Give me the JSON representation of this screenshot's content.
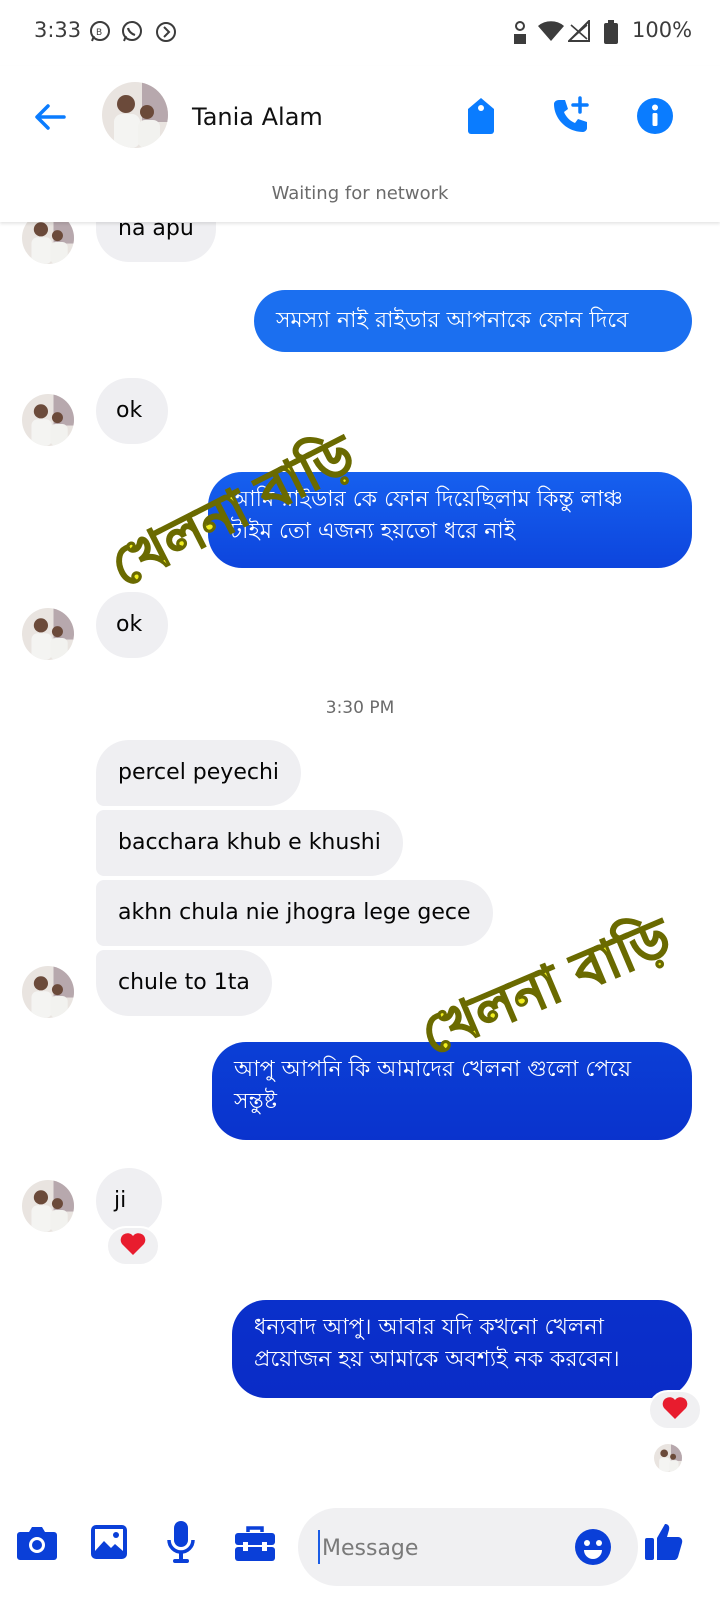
{
  "status_bar": {
    "time": "3:33",
    "battery": "100%",
    "icons": [
      "whatsapp-business-icon",
      "whatsapp-icon",
      "data-saver-icon",
      "location-icon",
      "wifi-icon",
      "signal-icon",
      "battery-icon"
    ]
  },
  "header": {
    "contact_name": "Tania Alam",
    "network_status": "Waiting for network",
    "icons": [
      "back-arrow-icon",
      "tag-icon",
      "add-call-icon",
      "info-icon"
    ]
  },
  "messages": [
    {
      "side": "in",
      "text": "na apu"
    },
    {
      "side": "out",
      "text": "সমস্যা নাই রাইডার আপনাকে ফোন দিবে"
    },
    {
      "side": "in",
      "text": "ok"
    },
    {
      "side": "out",
      "text": "আমি রাইডার কে ফোন দিয়েছিলাম কিন্তু লাঞ্চ টাইম তো এজন্য হয়তো ধরে নাই"
    },
    {
      "side": "in",
      "text": "ok"
    },
    {
      "side": "in",
      "text": "percel peyechi"
    },
    {
      "side": "in",
      "text": "bacchara khub e khushi"
    },
    {
      "side": "in",
      "text": "akhn chula nie jhogra lege gece"
    },
    {
      "side": "in",
      "text": "chule to 1ta"
    },
    {
      "side": "out",
      "text": "আপু আপনি কি আমাদের খেলনা গুলো পেয়ে সন্তুষ্ট"
    },
    {
      "side": "in",
      "text": "ji",
      "reaction": "heart"
    },
    {
      "side": "out",
      "text": "ধন্যবাদ আপু। আবার যদি কখনো খেলনা প্রয়োজন হয় আমাকে অবশ্যই নক করবেন।",
      "reaction": "heart"
    }
  ],
  "time_divider": "3:30 PM",
  "watermark": {
    "text": "খেলনা বাড়ি",
    "color": "#f2ef1e"
  },
  "composer": {
    "placeholder": "Message",
    "icons": [
      "camera-icon",
      "gallery-icon",
      "microphone-icon",
      "toolbox-icon",
      "emoji-icon",
      "thumbs-up-icon"
    ]
  },
  "colors": {
    "accent": "#0a7cff",
    "incoming_bubble": "#efeff2",
    "outgoing_gradient": [
      "#1877f2",
      "#0b3fd6",
      "#0a2fc9"
    ],
    "heart": "#e81c2e"
  }
}
